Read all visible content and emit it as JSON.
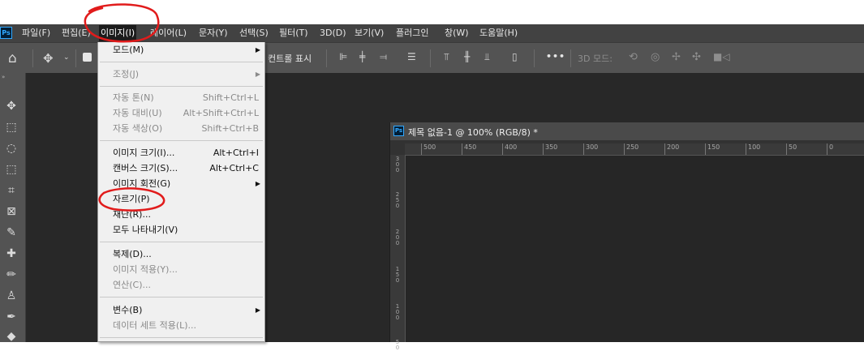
{
  "app": {
    "logo": "Ps"
  },
  "menubar": {
    "items": [
      "파일(F)",
      "편집(E)",
      "이미지(I)",
      "레이어(L)",
      "문자(Y)",
      "선택(S)",
      "필터(T)",
      "3D(D)",
      "보기(V)",
      "플러그인",
      "창(W)",
      "도움말(H)"
    ]
  },
  "options_bar": {
    "show_transform_label": "컨트롤 표시",
    "mode_3d_label": "3D 모드:",
    "more_label": "•••"
  },
  "document": {
    "tab_icon": "Ps",
    "title": "제목 없음-1 @ 100% (RGB/8) *",
    "ruler_h": [
      "500",
      "450",
      "400",
      "350",
      "300",
      "250",
      "200",
      "150",
      "100",
      "50",
      "0"
    ],
    "ruler_v": [
      "3\n0\n0",
      "2\n5\n0",
      "2\n0\n0",
      "1\n5\n0",
      "1\n0\n0",
      "5\n0"
    ]
  },
  "dropdown": {
    "mode": "모드(M)",
    "adjust": "조정(J)",
    "auto_tone": "자동 톤(N)",
    "auto_tone_sc": "Shift+Ctrl+L",
    "auto_contrast": "자동 대비(U)",
    "auto_contrast_sc": "Alt+Shift+Ctrl+L",
    "auto_color": "자동 색상(O)",
    "auto_color_sc": "Shift+Ctrl+B",
    "image_size": "이미지 크기(I)...",
    "image_size_sc": "Alt+Ctrl+I",
    "canvas_size": "캔버스 크기(S)...",
    "canvas_size_sc": "Alt+Ctrl+C",
    "rotate": "이미지 회전(G)",
    "crop": "자르기(P)",
    "trim": "재단(R)...",
    "reveal_all": "모두 나타내기(V)",
    "duplicate": "복제(D)...",
    "apply_image": "이미지 적용(Y)...",
    "calculations": "연산(C)...",
    "variables": "변수(B)",
    "apply_data_set": "데이터 세트 적용(L)..."
  },
  "colors": {
    "annotation": "#e11b1b",
    "accent": "#31a8ff"
  }
}
